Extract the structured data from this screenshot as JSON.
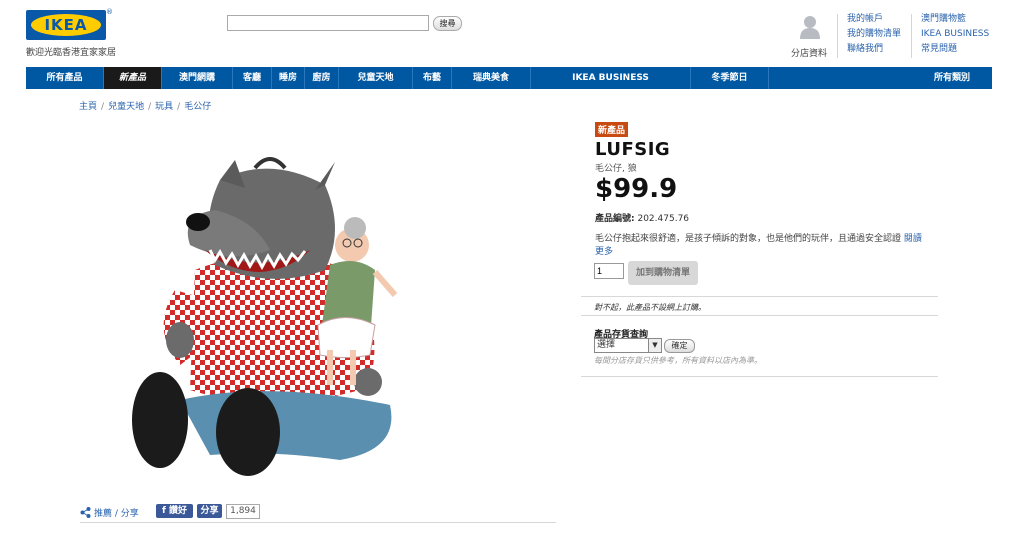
{
  "header": {
    "logo_text": "IKEA",
    "logo_mark": "®",
    "tagline": "歡迎光臨香港宜家家居",
    "search_placeholder": "",
    "search_button": "搜尋",
    "store_label": "分店資料",
    "links_col1": [
      "我的帳戶",
      "我的購物清單",
      "聯絡我們"
    ],
    "links_col2": [
      "澳門購物籃",
      "IKEA BUSINESS",
      "常見問題"
    ]
  },
  "nav": {
    "items": [
      "所有產品",
      "新產品",
      "澳門網購",
      "客廳",
      "睡房",
      "廚房",
      "兒童天地",
      "布藝",
      "瑞典美食",
      "IKEA BUSINESS",
      "冬季節日",
      "所有類別"
    ],
    "active_index": 1
  },
  "breadcrumb": [
    "主頁",
    "兒童天地",
    "玩具",
    "毛公仔"
  ],
  "product": {
    "badge": "新產品",
    "name": "LUFSIG",
    "type": "毛公仔, 狼",
    "price": "$99.9",
    "article_label": "產品編號:",
    "article_number": "202.475.76",
    "description": "毛公仔抱起來很舒適，是孩子傾訴的對象，也是他們的玩伴，且通過安全認證",
    "more_link": "閱讀更多",
    "quantity": "1",
    "add_to_list": "加到購物清單",
    "not_online": "對不起，此產品不設網上訂購。",
    "stock_title": "產品存貨查詢",
    "stock_select": "選擇",
    "confirm": "確定",
    "stock_disclaimer": "每間分店存貨只供參考，所有資料以店內為準。"
  },
  "share": {
    "share_label": "推薦 / 分享",
    "like_label": "讚好",
    "fb_share_label": "分享",
    "count": "1,894"
  },
  "colors": {
    "ikea_blue": "#0058a3",
    "ikea_yellow": "#ffcc00",
    "new_badge": "#c84a10",
    "link": "#2a63ad",
    "facebook": "#3b5998"
  }
}
